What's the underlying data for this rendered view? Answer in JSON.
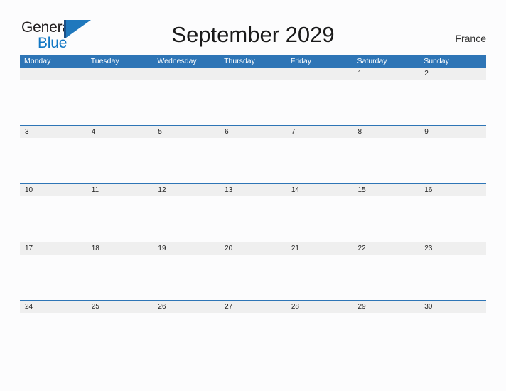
{
  "brand": {
    "name_part1": "General",
    "name_part2": "Blue",
    "flag_icon": "triangle-flag-icon"
  },
  "header": {
    "title": "September 2029",
    "region": "France"
  },
  "calendar": {
    "weekdays": [
      "Monday",
      "Tuesday",
      "Wednesday",
      "Thursday",
      "Friday",
      "Saturday",
      "Sunday"
    ],
    "weeks": [
      {
        "days": [
          "",
          "",
          "",
          "",
          "",
          "1",
          "2"
        ]
      },
      {
        "days": [
          "3",
          "4",
          "5",
          "6",
          "7",
          "8",
          "9"
        ]
      },
      {
        "days": [
          "10",
          "11",
          "12",
          "13",
          "14",
          "15",
          "16"
        ]
      },
      {
        "days": [
          "17",
          "18",
          "19",
          "20",
          "21",
          "22",
          "23"
        ]
      },
      {
        "days": [
          "24",
          "25",
          "26",
          "27",
          "28",
          "29",
          "30"
        ]
      }
    ]
  },
  "colors": {
    "header_blue": "#2e75b6",
    "band_gray": "#efefef",
    "brand_blue": "#1177c4",
    "page_bg": "#fcfcfd"
  }
}
